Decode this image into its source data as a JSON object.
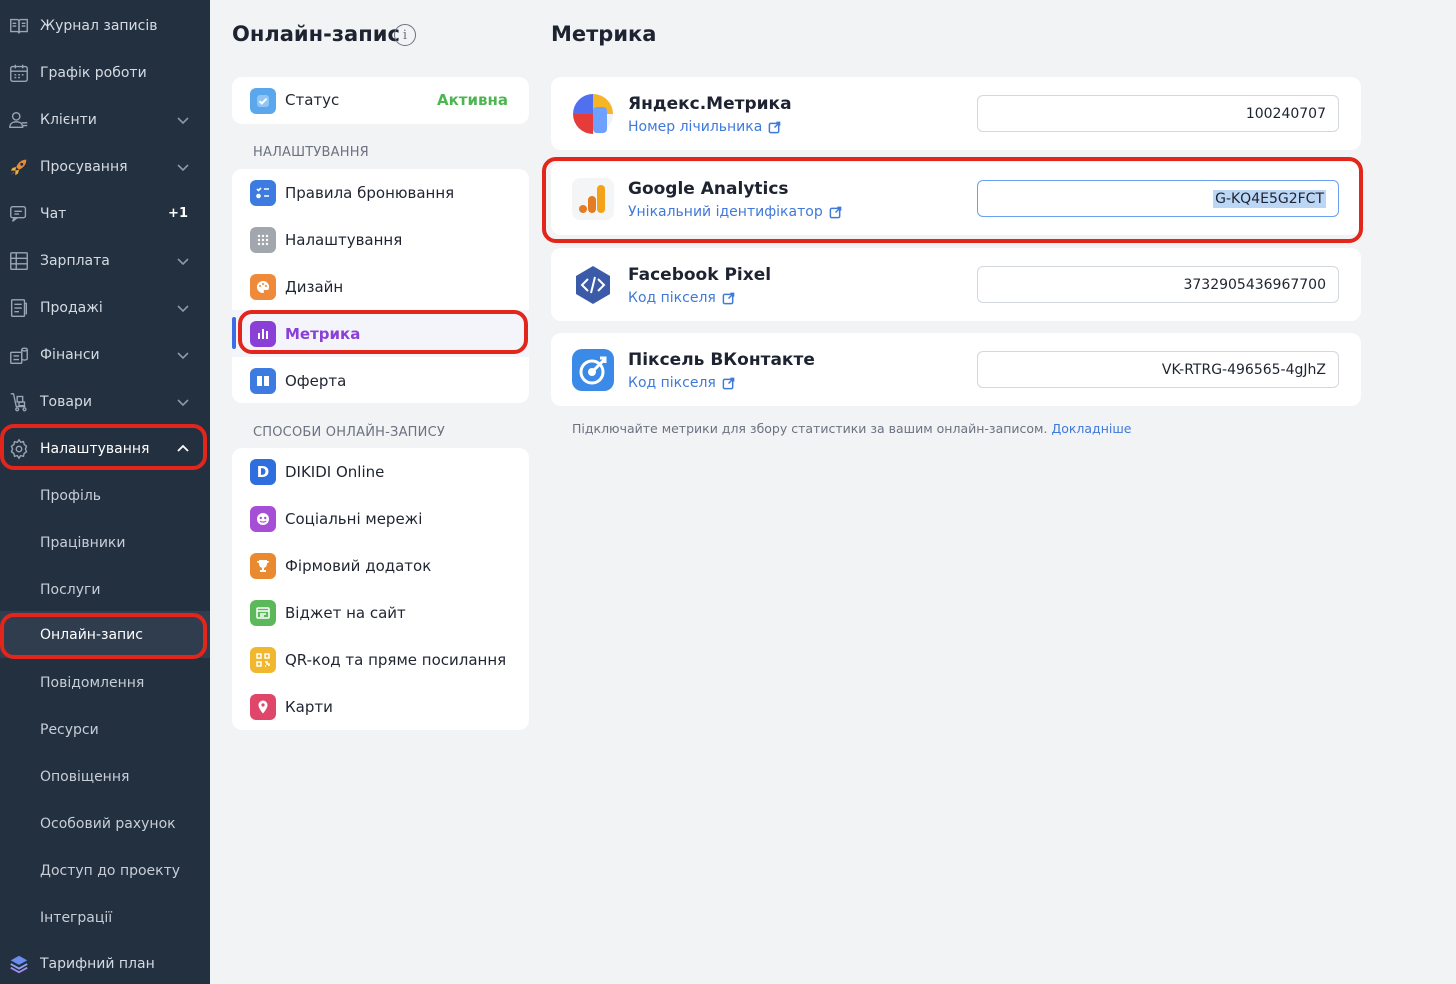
{
  "sidebar": {
    "items": [
      {
        "label": "Журнал записів",
        "icon": "journal-icon"
      },
      {
        "label": "Графік роботи",
        "icon": "calendar-icon"
      },
      {
        "label": "Клієнти",
        "icon": "clients-icon"
      },
      {
        "label": "Просування",
        "icon": "rocket-icon"
      },
      {
        "label": "Чат",
        "icon": "chat-icon",
        "badge": "+1"
      },
      {
        "label": "Зарплата",
        "icon": "salary-icon"
      },
      {
        "label": "Продажі",
        "icon": "sales-icon"
      },
      {
        "label": "Фінанси",
        "icon": "finance-icon"
      },
      {
        "label": "Товари",
        "icon": "goods-icon"
      },
      {
        "label": "Налаштування",
        "icon": "gear-icon"
      }
    ],
    "subitems": [
      "Профіль",
      "Працівники",
      "Послуги",
      "Онлайн-запис",
      "Повідомлення",
      "Ресурси",
      "Оповіщення",
      "Особовий рахунок",
      "Доступ до проекту",
      "Інтеграції"
    ],
    "bottom": {
      "label": "Тарифний план",
      "icon": "layers-icon"
    }
  },
  "middle": {
    "title": "Онлайн-запис",
    "status": {
      "label": "Статус",
      "value": "Активна"
    },
    "settings_section": "НАЛАШТУВАННЯ",
    "settings": [
      {
        "label": "Правила бронювання",
        "color": "#3d7be0"
      },
      {
        "label": "Налаштування",
        "color": "#9aa0a8"
      },
      {
        "label": "Дизайн",
        "color": "#ee8a3a"
      },
      {
        "label": "Метрика",
        "color": "#8a3fd6"
      },
      {
        "label": "Оферта",
        "color": "#3d7be0"
      }
    ],
    "ways_section": "СПОСОБИ ОНЛАЙН-ЗАПИСУ",
    "ways": [
      {
        "label": "DIKIDI Online",
        "color": "#2f6fdd"
      },
      {
        "label": "Соціальні мережі",
        "color": "#a64fd6"
      },
      {
        "label": "Фірмовий додаток",
        "color": "#e98a30"
      },
      {
        "label": "Віджет на сайт",
        "color": "#5bb85b"
      },
      {
        "label": "QR-код та пряме посилання",
        "color": "#f0b72f"
      },
      {
        "label": "Карти",
        "color": "#e0466a"
      }
    ]
  },
  "right": {
    "title": "Метрика",
    "metrics": [
      {
        "name": "Яндекс.Метрика",
        "link": "Номер лічильника",
        "value": "100240707"
      },
      {
        "name": "Google Analytics",
        "link": "Унікальний ідентифікатор",
        "value": "G-KQ4E5G2FCT"
      },
      {
        "name": "Facebook Pixel",
        "link": "Код пікселя",
        "value": "3732905436967700"
      },
      {
        "name": "Піксель ВКонтакте",
        "link": "Код пікселя",
        "value": "VK-RTRG-496565-4gJhZ"
      }
    ],
    "footnote": "Підключайте метрики для збору статистики за вашим онлайн-записом.",
    "footnote_link": "Докладніше"
  }
}
